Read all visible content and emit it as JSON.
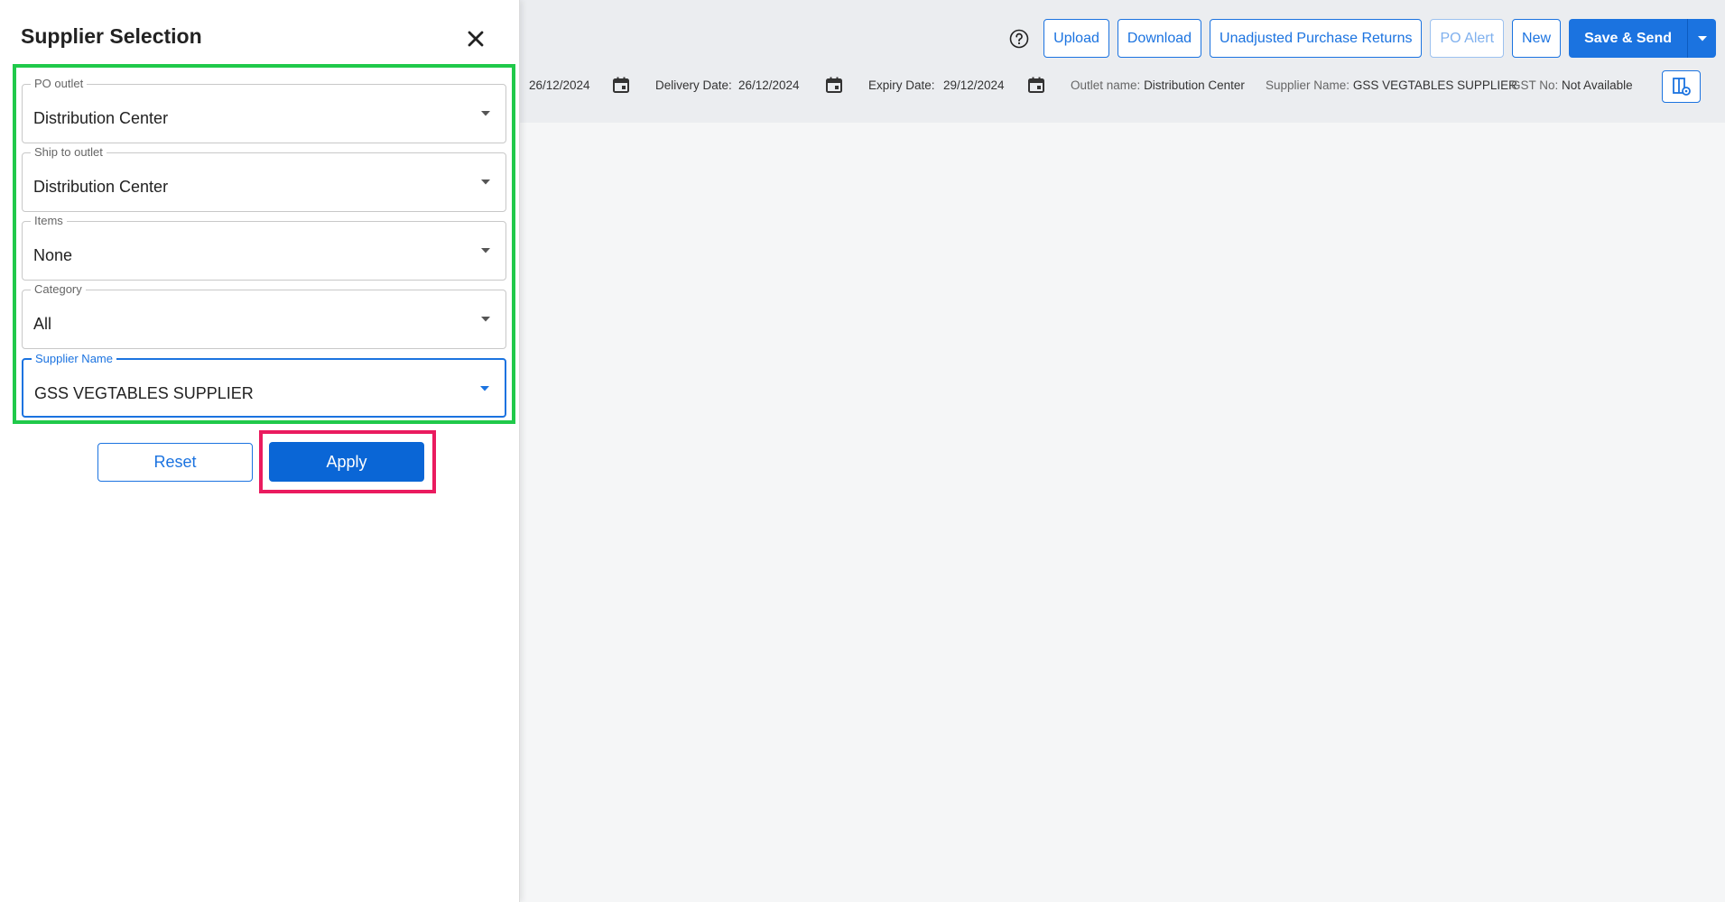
{
  "panel": {
    "title": "Supplier Selection",
    "fields": [
      {
        "label": "PO outlet",
        "value": "Distribution Center"
      },
      {
        "label": "Ship to outlet",
        "value": "Distribution Center"
      },
      {
        "label": "Items",
        "value": "None"
      },
      {
        "label": "Category",
        "value": "All"
      },
      {
        "label": "Supplier Name",
        "value": "GSS VEGTABLES SUPPLIER"
      }
    ],
    "reset_label": "Reset",
    "apply_label": "Apply"
  },
  "toolbar": {
    "upload_label": "Upload",
    "download_label": "Download",
    "unadjusted_label": "Unadjusted Purchase Returns",
    "po_alert_label": "PO Alert",
    "new_label": "New",
    "save_send_label": "Save & Send"
  },
  "info": {
    "po_date": "26/12/2024",
    "delivery_label": "Delivery Date:",
    "delivery_date": "26/12/2024",
    "expiry_label": "Expiry Date:",
    "expiry_date": "29/12/2024",
    "outlet_label": "Outlet name:",
    "outlet_value": "Distribution Center",
    "supplier_label": "Supplier Name:",
    "supplier_value": "GSS VEGTABLES SUPPLIER",
    "gst_label": "GST No:",
    "gst_value": "Not Available"
  },
  "colors": {
    "primary": "#1b73e0",
    "apply": "#0a66d6",
    "group_highlight": "#20c94a",
    "apply_highlight": "#ea1b5f"
  }
}
